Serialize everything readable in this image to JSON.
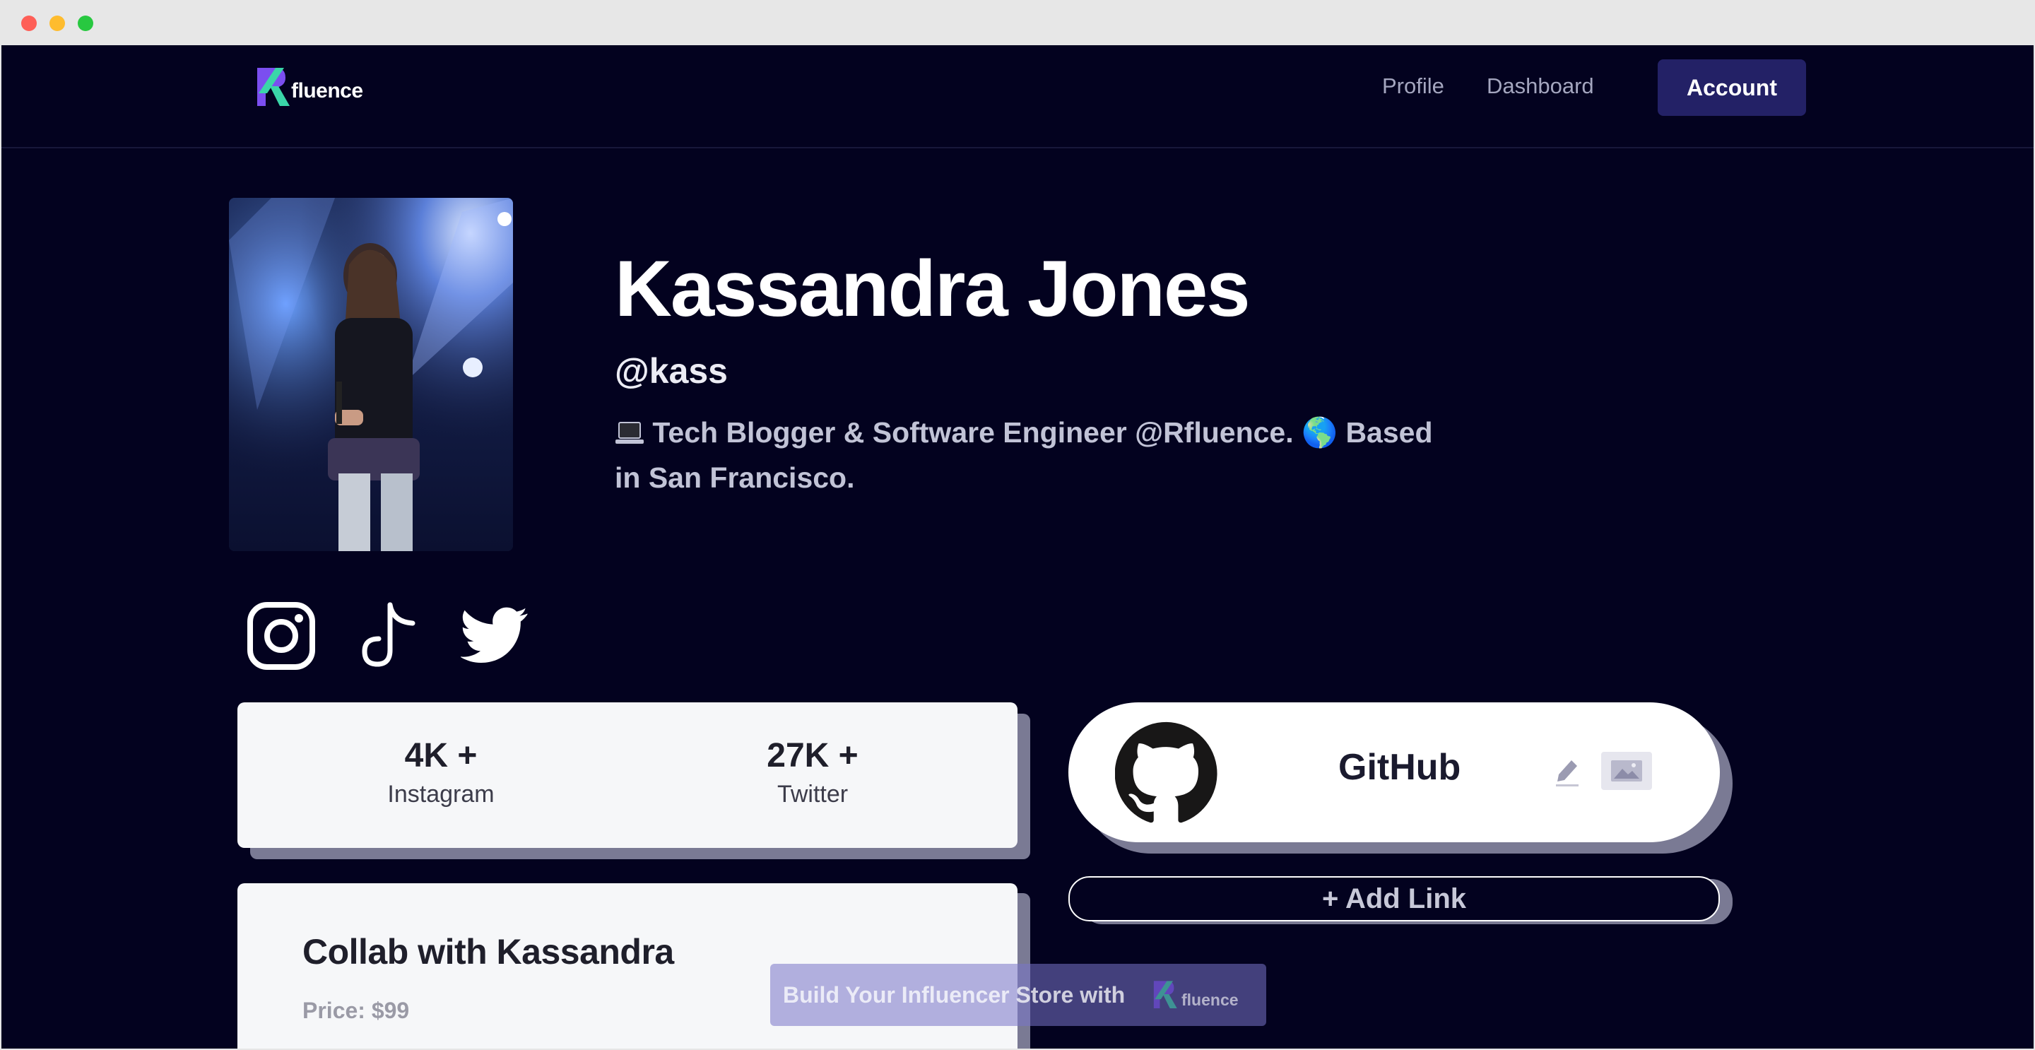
{
  "window": {
    "buttons": [
      "close",
      "minimize",
      "zoom"
    ]
  },
  "nav": {
    "logo_text": "fluence",
    "links": [
      "Profile",
      "Dashboard"
    ],
    "account_label": "Account"
  },
  "profile": {
    "name": "Kassandra Jones",
    "handle": "@kass",
    "bio": "Tech Blogger & Software Engineer @Rfluence. 🌎 Based in San Francisco."
  },
  "social_icons": [
    "instagram-icon",
    "tiktok-icon",
    "twitter-icon"
  ],
  "stats": [
    {
      "value": "4K +",
      "label": "Instagram"
    },
    {
      "value": "27K +",
      "label": "Twitter"
    }
  ],
  "collab": {
    "title": "Collab with Kassandra",
    "price": "Price: $99"
  },
  "links": [
    {
      "title": "GitHub",
      "icon": "github-icon"
    }
  ],
  "add_link_label": "+ Add Link",
  "promo": {
    "text": "Build Your Influencer Store with",
    "logo_text": "fluence"
  },
  "colors": {
    "background": "#03021f",
    "accent": "#232166",
    "card": "#f6f7f9",
    "card_shadow": "#7a7a94",
    "logo_green": "#3ad6a8",
    "logo_purple": "#7b4ef0"
  }
}
